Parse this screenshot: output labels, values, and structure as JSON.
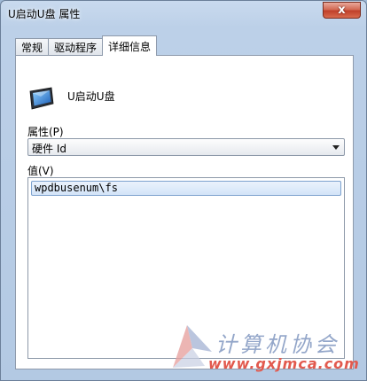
{
  "window": {
    "title": "U启动U盘 属性",
    "close_glyph": "x"
  },
  "tabs": [
    {
      "label": "常规",
      "active": false
    },
    {
      "label": "驱动程序",
      "active": false
    },
    {
      "label": "详细信息",
      "active": true
    }
  ],
  "device": {
    "name": "U启动U盘",
    "icon": "portable-device-icon"
  },
  "property": {
    "label": "属性(P)",
    "selected": "硬件 Id"
  },
  "value": {
    "label": "值(V)",
    "items": [
      "wpdbusenum\\fs"
    ]
  },
  "watermark": {
    "title": "计算机协会",
    "url": "www.gxjmca.com"
  },
  "colors": {
    "close": "#c7462f",
    "selection": "#d8e7f9",
    "watermark_blue": "#93a6c9",
    "watermark_red": "#e25a4e"
  }
}
